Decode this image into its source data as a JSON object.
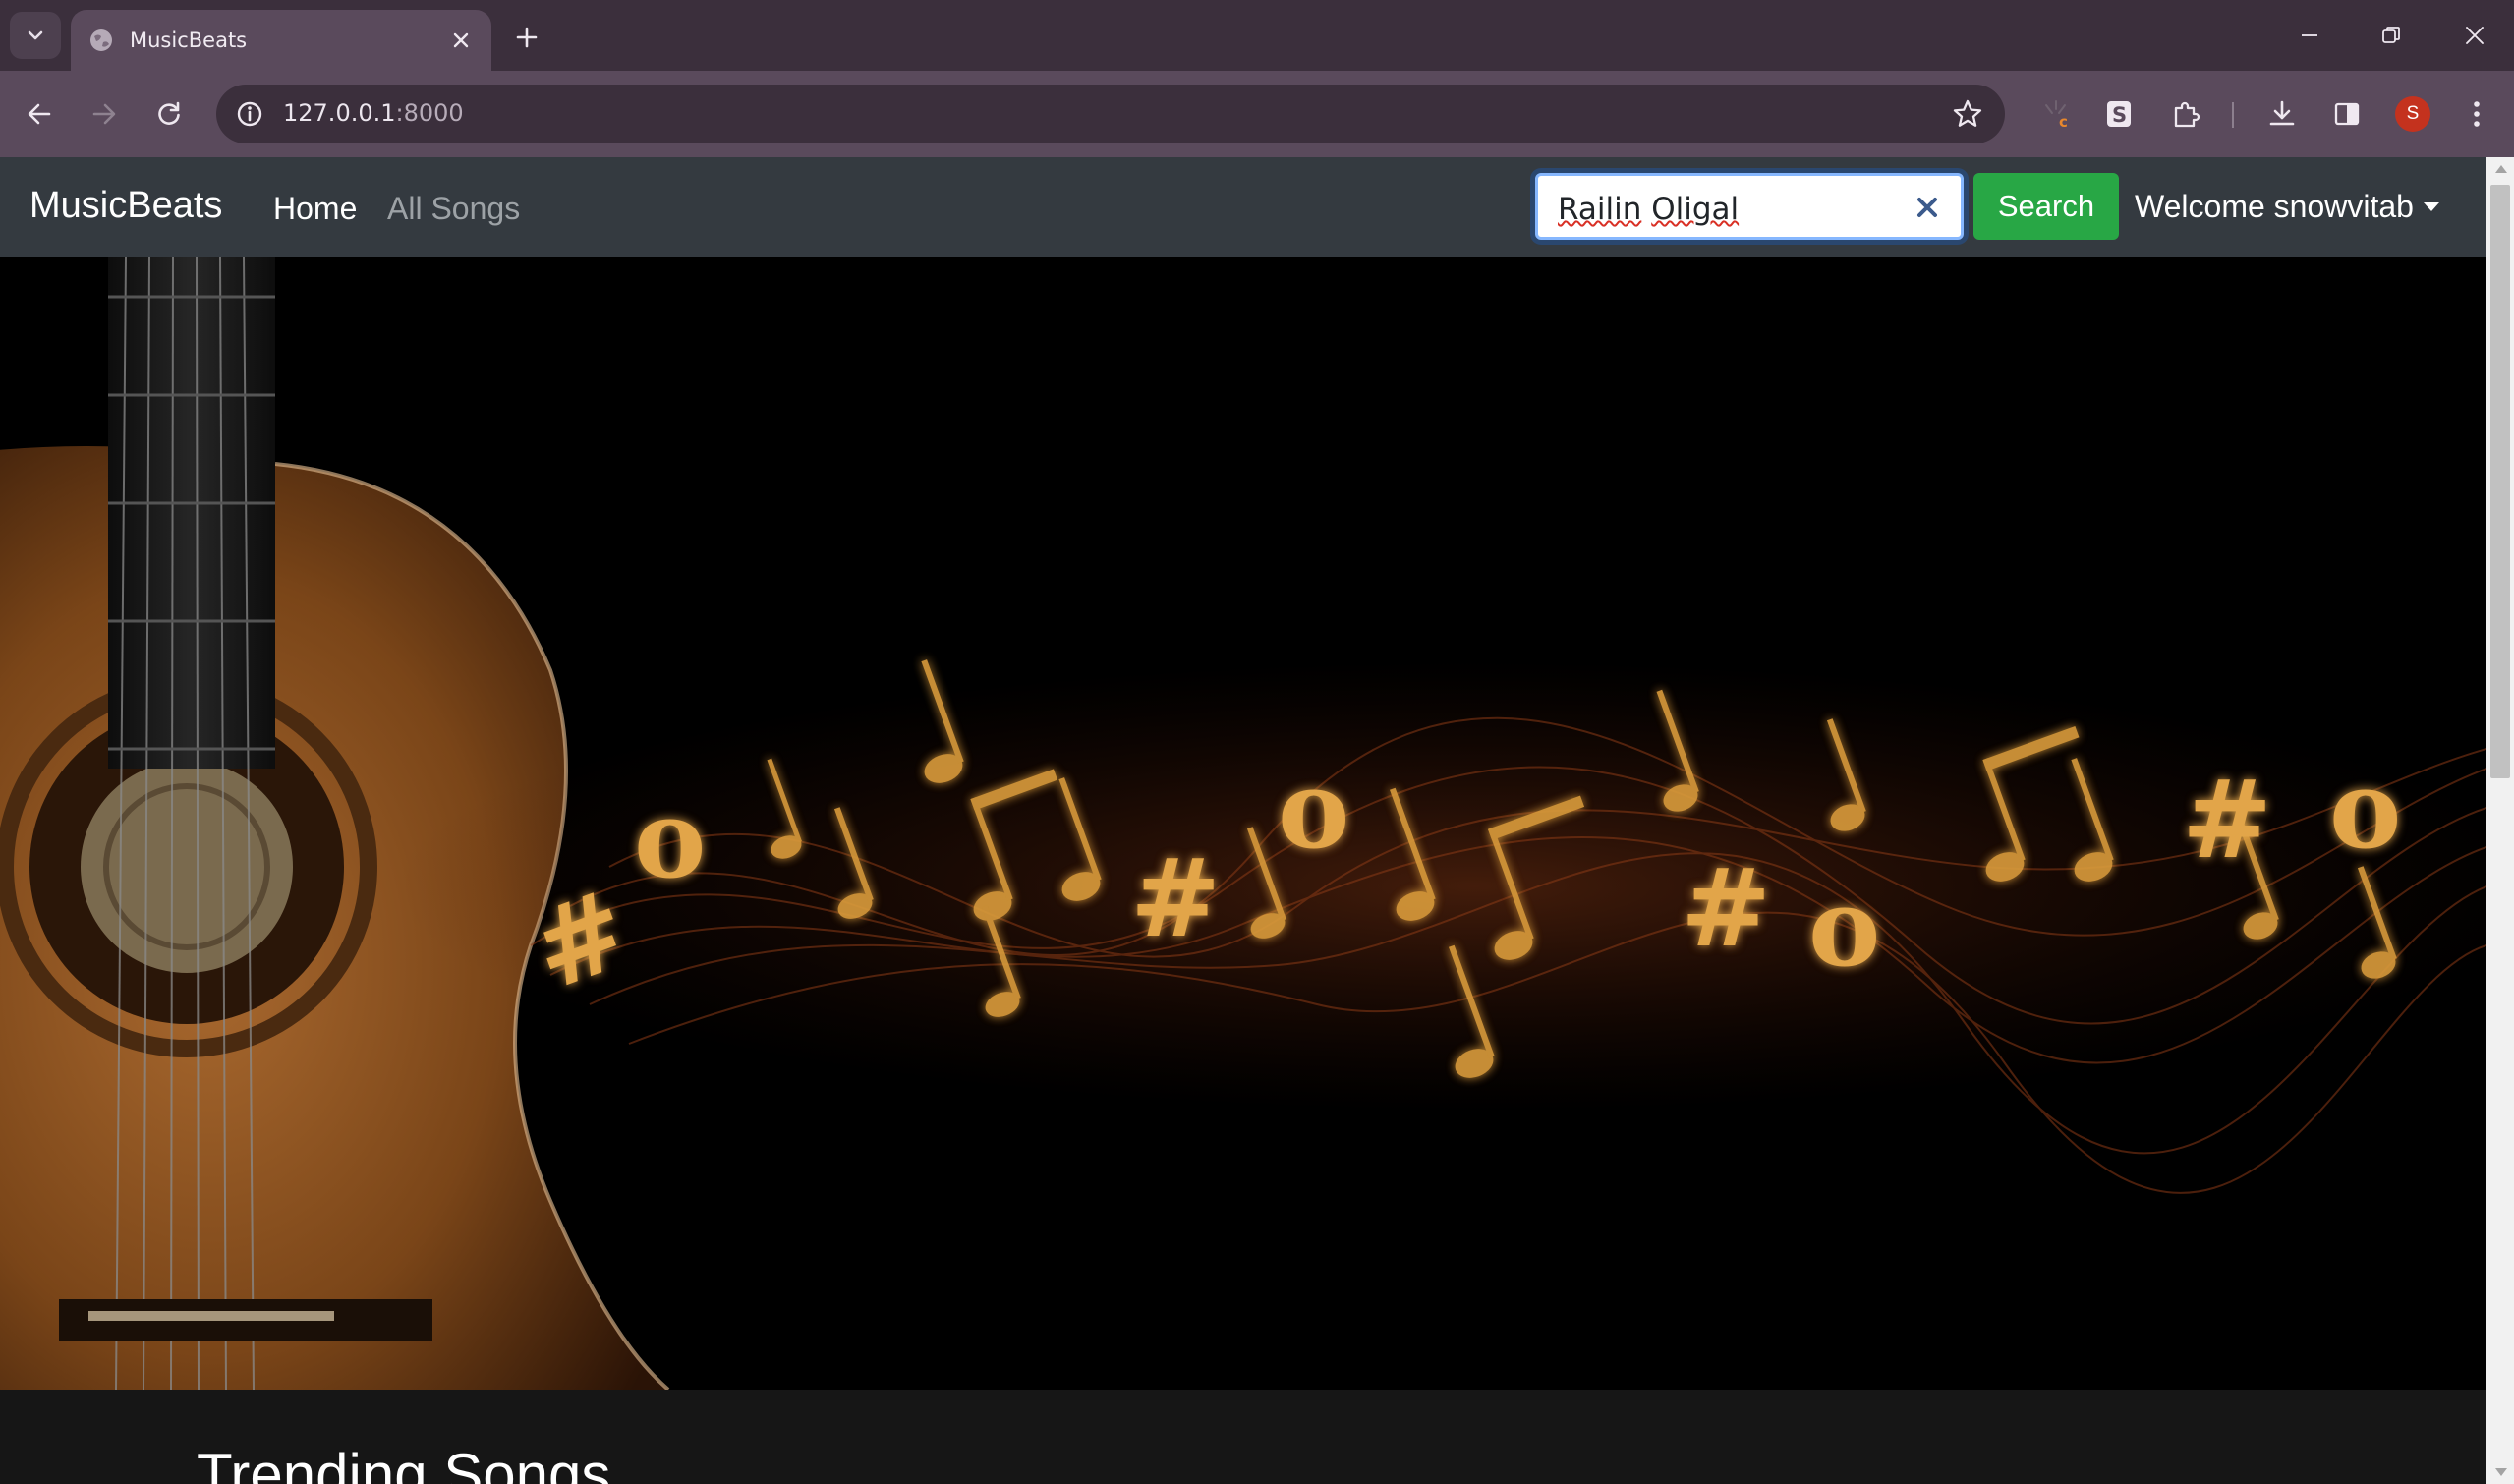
{
  "browser": {
    "tab_title": "MusicBeats",
    "url_host": "127.0.0.1",
    "url_port": ":8000",
    "profile_initial": "S"
  },
  "site": {
    "brand": "MusicBeats",
    "nav": {
      "home": "Home",
      "all_songs": "All Songs"
    },
    "search": {
      "value_word1": "Railin",
      "value_word2": "Oligal",
      "button": "Search"
    },
    "user_menu": "Welcome snowvitab"
  },
  "hero": {
    "symbols": [
      "#",
      "o",
      "#",
      "o",
      "#",
      "o",
      "#",
      "o"
    ]
  },
  "sections": {
    "trending_title": "Trending Songs"
  },
  "colors": {
    "navbar": "#343a40",
    "search_button": "#28a745",
    "note_gold": "#d89a3a",
    "browser_frame": "#3b2f3c"
  }
}
